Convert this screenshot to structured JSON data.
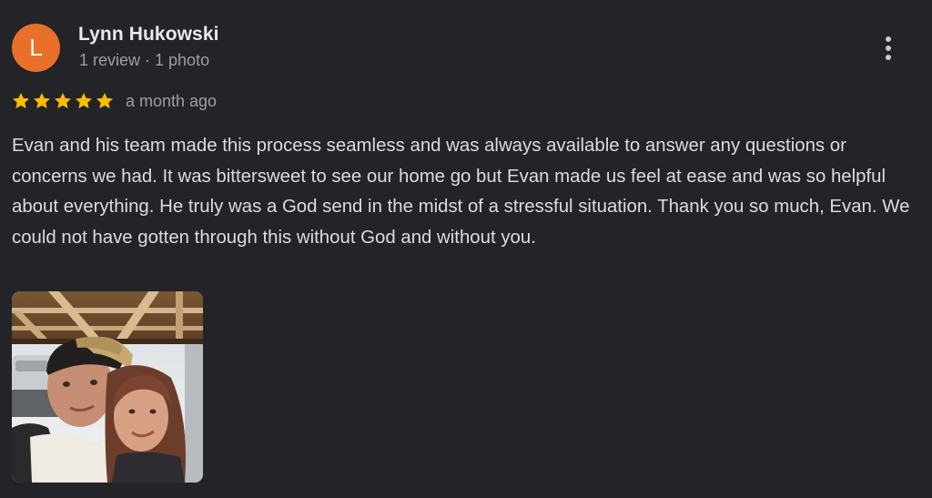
{
  "review": {
    "author": {
      "initial": "L",
      "name": "Lynn Hukowski",
      "meta": "1 review · 1 photo",
      "avatar_color": "#e8702a"
    },
    "rating": 5,
    "rating_max": 5,
    "star_color": "#fbbc04",
    "date": "a month ago",
    "text": "Evan and his team made this process seamless and was always available to answer any questions or concerns we had. It was bittersweet to see our home go but Evan made us feel at ease and was so helpful about everything. He truly was a God send in the midst of a stressful situation. Thank you so much, Evan. We could not have gotten through this without God and without you.",
    "menu_icon": "more-vert-icon",
    "photo_count": 1
  }
}
